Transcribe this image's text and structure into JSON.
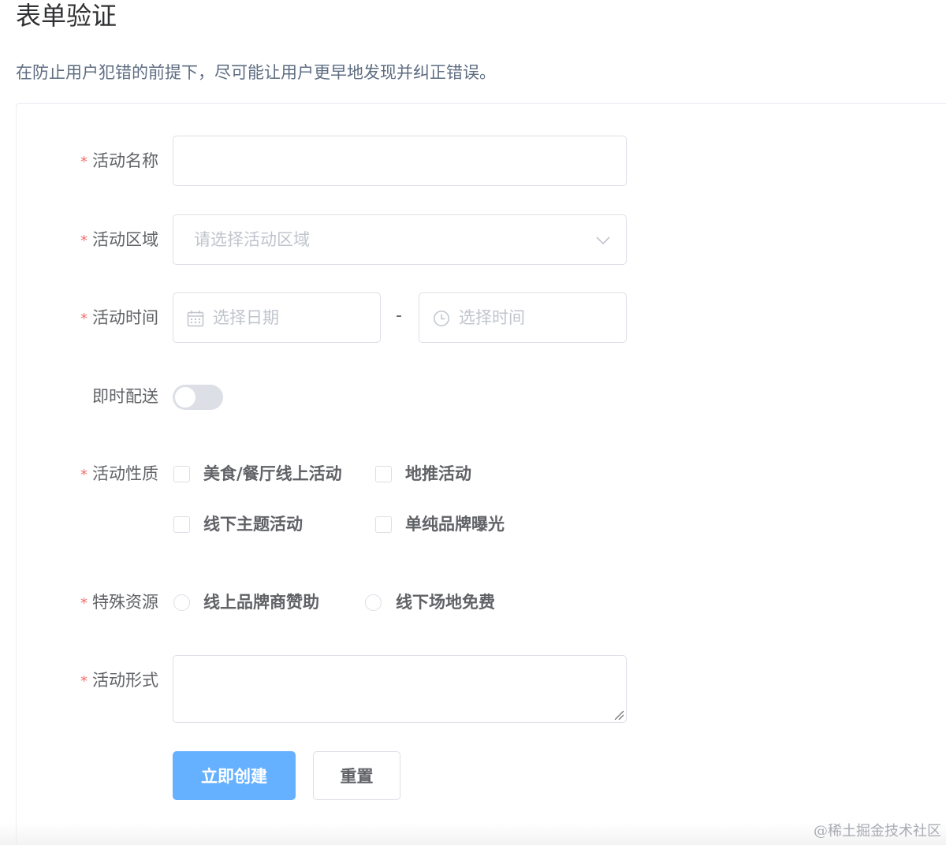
{
  "page": {
    "title": "表单验证",
    "description": "在防止用户犯错的前提下，尽可能让用户更早地发现并纠正错误。"
  },
  "form": {
    "required_mark": "*",
    "name": {
      "label": "活动名称",
      "value": ""
    },
    "region": {
      "label": "活动区域",
      "placeholder": "请选择活动区域",
      "icon": "chevron-down-icon"
    },
    "time": {
      "label": "活动时间",
      "date_placeholder": "选择日期",
      "date_icon": "calendar-icon",
      "separator": "-",
      "time_placeholder": "选择时间",
      "time_icon": "clock-icon"
    },
    "delivery": {
      "label": "即时配送",
      "on": false
    },
    "type": {
      "label": "活动性质",
      "options": [
        {
          "label": "美食/餐厅线上活动",
          "checked": false
        },
        {
          "label": "地推活动",
          "checked": false
        },
        {
          "label": "线下主题活动",
          "checked": false
        },
        {
          "label": "单纯品牌曝光",
          "checked": false
        }
      ]
    },
    "resource": {
      "label": "特殊资源",
      "options": [
        {
          "label": "线上品牌商赞助",
          "selected": false
        },
        {
          "label": "线下场地免费",
          "selected": false
        }
      ]
    },
    "desc": {
      "label": "活动形式",
      "value": ""
    },
    "buttons": {
      "submit": "立即创建",
      "reset": "重置"
    }
  },
  "watermark": "@稀土掘金技术社区",
  "colors": {
    "required": "#f56c6c",
    "primary_button": "#66b1ff",
    "border": "#dcdfe6",
    "placeholder": "#c0c4cc"
  }
}
